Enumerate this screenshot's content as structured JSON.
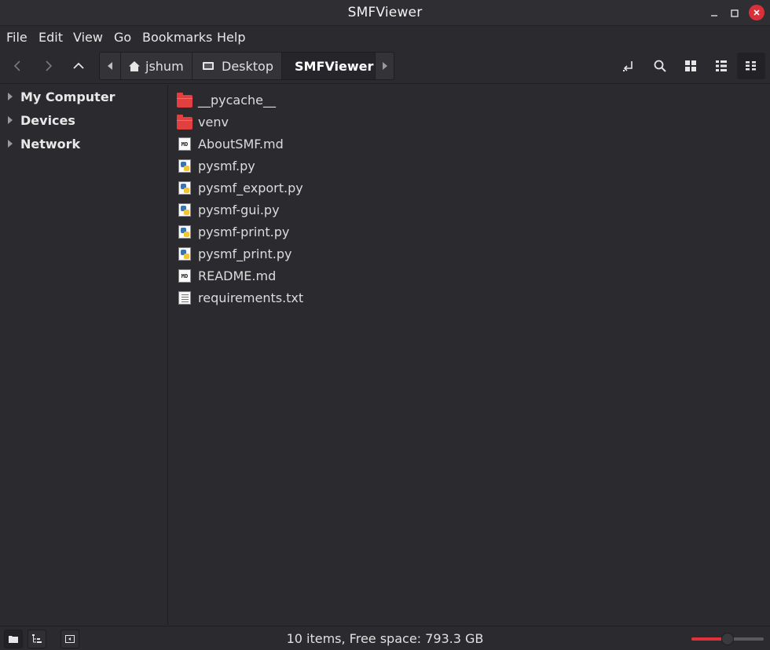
{
  "window": {
    "title": "SMFViewer"
  },
  "menu": [
    "File",
    "Edit",
    "View",
    "Go",
    "Bookmarks",
    "Help"
  ],
  "breadcrumbs": {
    "home": "jshum",
    "desktop": "Desktop",
    "current": "SMFViewer"
  },
  "sidebar": {
    "items": [
      {
        "label": "My Computer"
      },
      {
        "label": "Devices"
      },
      {
        "label": "Network"
      }
    ]
  },
  "files": [
    {
      "name": "__pycache__",
      "type": "folder"
    },
    {
      "name": "venv",
      "type": "folder"
    },
    {
      "name": "AboutSMF.md",
      "type": "markdown"
    },
    {
      "name": "pysmf.py",
      "type": "python"
    },
    {
      "name": "pysmf_export.py",
      "type": "python"
    },
    {
      "name": "pysmf-gui.py",
      "type": "python"
    },
    {
      "name": "pysmf-print.py",
      "type": "python"
    },
    {
      "name": "pysmf_print.py",
      "type": "python"
    },
    {
      "name": "README.md",
      "type": "markdown"
    },
    {
      "name": "requirements.txt",
      "type": "text"
    }
  ],
  "icons": {
    "folder": "folder-icon",
    "markdown": "markdown-file-icon",
    "python": "python-file-icon",
    "text": "text-file-icon"
  },
  "status": {
    "text": "10 items, Free space: 793.3 GB",
    "zoom_level": 0.5
  },
  "colors": {
    "accent": "#e0303a",
    "folder": "#e0403f"
  }
}
